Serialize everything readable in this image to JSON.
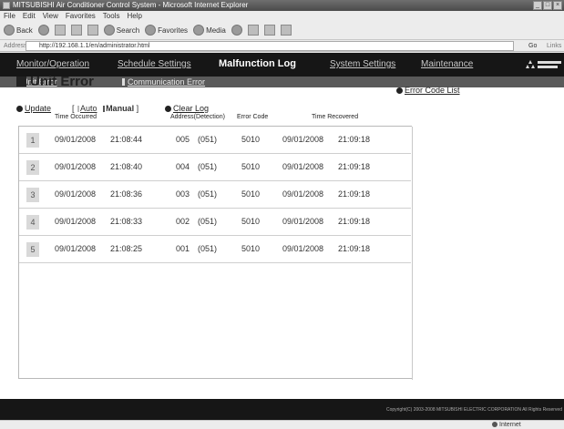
{
  "browser": {
    "title": "MITSUBISHI Air Conditioner Control System - Microsoft Internet Explorer",
    "menu": [
      "File",
      "Edit",
      "View",
      "Favorites",
      "Tools",
      "Help"
    ],
    "toolbar": {
      "back": "Back",
      "search": "Search",
      "favorites": "Favorites",
      "media": "Media"
    },
    "address_label": "Address",
    "address": "http://192.168.1.1/en/administrator.html",
    "go": "Go",
    "links": "Links",
    "status_zone": "Internet"
  },
  "nav": {
    "items": [
      {
        "label": "Monitor/Operation"
      },
      {
        "label": "Schedule Settings"
      },
      {
        "label": "Malfunction Log"
      },
      {
        "label": "System Settings"
      },
      {
        "label": "Maintenance"
      }
    ],
    "active": "Malfunction Log"
  },
  "subnav": {
    "items": [
      {
        "label": "Unit Error"
      },
      {
        "label": "Communication Error"
      }
    ]
  },
  "page": {
    "title": "Unit Error",
    "error_code_list": "Error Code List",
    "update": "Update",
    "mode_open": "[",
    "auto": "Auto",
    "manual": "Manual",
    "mode_close": "]",
    "clear_log": "Clear Log"
  },
  "table": {
    "headers": {
      "time_occurred": "Time Occurred",
      "address": "Address(Detection)",
      "error_code": "Error Code",
      "time_recovered": "Time Recovered"
    },
    "rows": [
      {
        "num": "1",
        "date": "09/01/2008",
        "time": "21:08:44",
        "addr": "005",
        "det": "(051)",
        "code": "5010",
        "rdate": "09/01/2008",
        "rtime": "21:09:18"
      },
      {
        "num": "2",
        "date": "09/01/2008",
        "time": "21:08:40",
        "addr": "004",
        "det": "(051)",
        "code": "5010",
        "rdate": "09/01/2008",
        "rtime": "21:09:18"
      },
      {
        "num": "3",
        "date": "09/01/2008",
        "time": "21:08:36",
        "addr": "003",
        "det": "(051)",
        "code": "5010",
        "rdate": "09/01/2008",
        "rtime": "21:09:18"
      },
      {
        "num": "4",
        "date": "09/01/2008",
        "time": "21:08:33",
        "addr": "002",
        "det": "(051)",
        "code": "5010",
        "rdate": "09/01/2008",
        "rtime": "21:09:18"
      },
      {
        "num": "5",
        "date": "09/01/2008",
        "time": "21:08:25",
        "addr": "001",
        "det": "(051)",
        "code": "5010",
        "rdate": "09/01/2008",
        "rtime": "21:09:18"
      }
    ]
  },
  "footer": {
    "copyright": "Copyright(C) 2003-2008 MITSUBISHI ELECTRIC CORPORATION All Rights Reserved"
  }
}
